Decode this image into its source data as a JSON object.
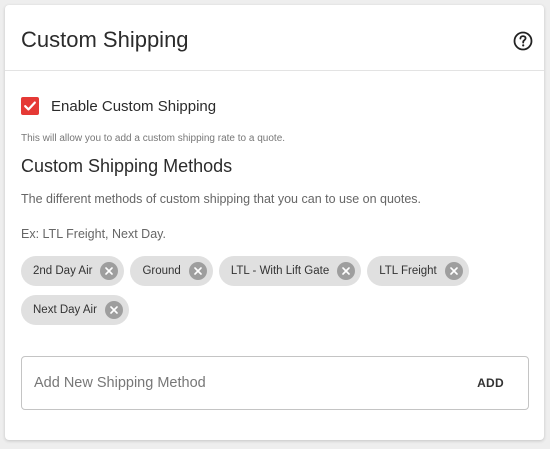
{
  "card": {
    "title": "Custom Shipping",
    "help_icon": "help-circle-icon"
  },
  "enable_custom_shipping": {
    "checked": true,
    "label": "Enable Custom Shipping",
    "helper": "This will allow you to add a custom shipping rate to a quote.",
    "checkbox_color": "#e53935"
  },
  "methods_section": {
    "title": "Custom Shipping Methods",
    "description": "The different methods of custom shipping that you can to use on quotes.",
    "example": "Ex: LTL Freight, Next Day."
  },
  "chips": [
    {
      "label": "2nd Day Air",
      "remove_icon": "close-circle-icon"
    },
    {
      "label": "Ground",
      "remove_icon": "close-circle-icon"
    },
    {
      "label": "LTL - With Lift Gate",
      "remove_icon": "close-circle-icon"
    },
    {
      "label": "LTL Freight",
      "remove_icon": "close-circle-icon"
    },
    {
      "label": "Next Day Air",
      "remove_icon": "close-circle-icon"
    }
  ],
  "add_method": {
    "placeholder": "Add New Shipping Method",
    "value": "",
    "button_label": "ADD"
  }
}
